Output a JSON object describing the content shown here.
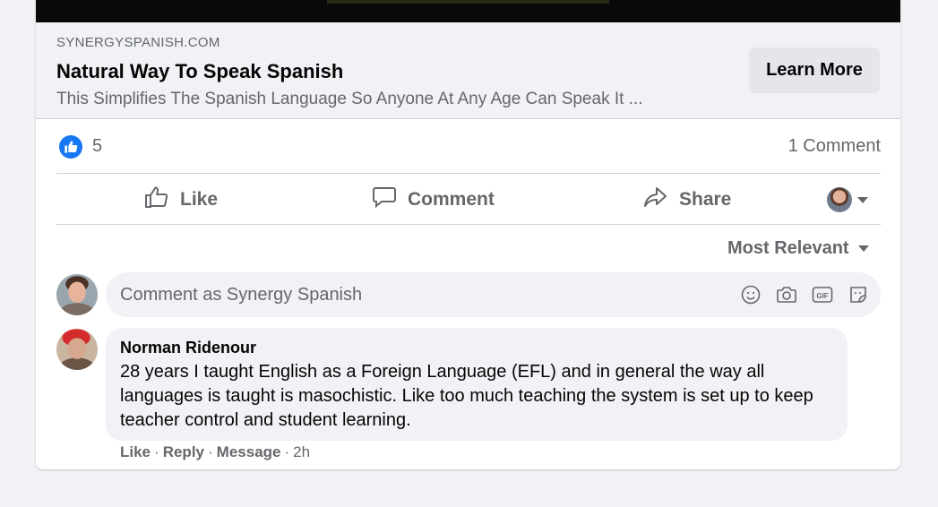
{
  "link_preview": {
    "domain": "SYNERGYSPANISH.COM",
    "title": "Natural Way To Speak Spanish",
    "description": "This Simplifies The Spanish Language So Anyone At Any Age Can Speak It ...",
    "cta_label": "Learn More"
  },
  "stats": {
    "like_count": "5",
    "comment_count": "1 Comment"
  },
  "actions": {
    "like": "Like",
    "comment": "Comment",
    "share": "Share"
  },
  "comments": {
    "sort_label": "Most Relevant",
    "input_placeholder": "Comment as Synergy Spanish",
    "items": [
      {
        "author": "Norman Ridenour",
        "text": "28 years I taught English as a Foreign Language (EFL) and in general the way all languages is taught is masochistic. Like too much teaching the system is set up to keep teacher control and student learning.",
        "like": "Like",
        "reply": "Reply",
        "message": "Message",
        "time": "2h"
      }
    ]
  },
  "colors": {
    "brand_blue": "#1877f2",
    "secondary_text": "#65676b",
    "surface": "#f0f2f5",
    "button_gray": "#e4e6eb"
  },
  "icons": [
    "like-reaction-icon",
    "thumbs-up-icon",
    "speech-bubble-icon",
    "share-arrow-icon",
    "emoji-icon",
    "camera-icon",
    "gif-icon",
    "sticker-icon"
  ]
}
